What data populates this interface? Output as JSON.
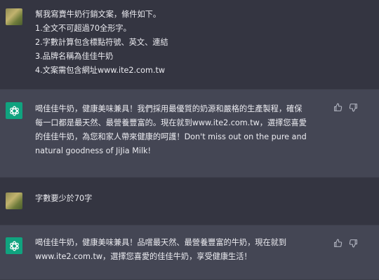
{
  "conversation": {
    "messages": [
      {
        "role": "user",
        "avatar_icon": "user-avatar-image",
        "lines": [
          "幫我寫賣牛奶行銷文案，條件如下。",
          "1.全文不可超過70全形字。",
          "2.字數計算包含標點符號、英文、連結",
          "3.品牌名稱為佳佳牛奶",
          "4.文案需包含網址www.ite2.com.tw"
        ]
      },
      {
        "role": "assistant",
        "avatar_icon": "chatgpt-logo-icon",
        "lines": [
          "喝佳佳牛奶，健康美味兼具！我們採用最優質的奶源和嚴格的生產製程，確保",
          "每一口都是最天然、最營養豐富的。現在就到www.ite2.com.tw，選擇您喜愛",
          "的佳佳牛奶，為您和家人帶來健康的呵護！Don't miss out on the pure and",
          "natural goodness of JiJia Milk!"
        ]
      },
      {
        "role": "user",
        "avatar_icon": "user-avatar-image",
        "lines": [
          "字數要少於70字"
        ]
      },
      {
        "role": "assistant",
        "avatar_icon": "chatgpt-logo-icon",
        "lines": [
          "喝佳佳牛奶，健康美味兼具！品嚐最天然、最營養豐富的牛奶，現在就到",
          "www.ite2.com.tw，選擇您喜愛的佳佳牛奶，享受健康生活！"
        ]
      }
    ]
  },
  "colors": {
    "user_bg": "#343541",
    "assistant_bg": "#444654",
    "text": "#ececf1",
    "brand_green": "#10a37f",
    "icon_gray": "#b5b8c4"
  },
  "icons": {
    "thumbs_up": "thumbs-up-icon",
    "thumbs_down": "thumbs-down-icon"
  }
}
